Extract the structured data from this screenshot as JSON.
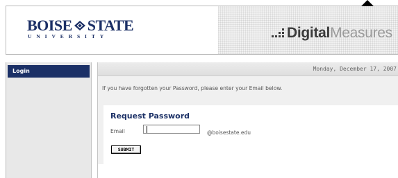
{
  "header": {
    "university_logo": {
      "word_left": "BOISE",
      "word_right": "STATE",
      "subtitle": "UNIVERSITY",
      "color": "#1b2f66"
    },
    "vendor_logo": {
      "bold": "Digital",
      "light": "Measures"
    }
  },
  "sidebar": {
    "items": [
      {
        "label": "Login",
        "active": true,
        "color": "#1b3066"
      }
    ]
  },
  "main": {
    "date": "Monday, December 17, 2007",
    "notice": "If you have forgotten your Password, please enter your Email below.",
    "form": {
      "title": "Request Password",
      "email_label": "Email",
      "email_value": "",
      "domain_suffix": "@boisestate.edu",
      "submit_label": "SUBMIT"
    }
  },
  "icons": [
    "boise-state-diamond-icon",
    "digital-measures-dots-icon",
    "cursor-arrow-icon"
  ]
}
